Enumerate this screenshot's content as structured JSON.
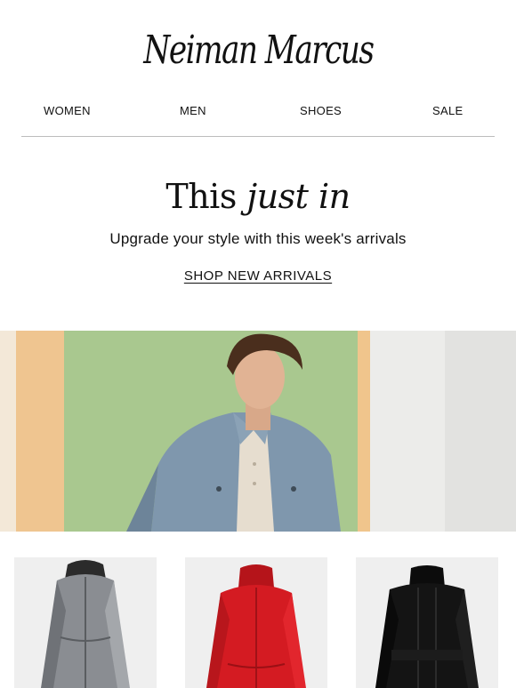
{
  "brand": {
    "logo_text": "Neiman Marcus"
  },
  "nav": {
    "items": [
      {
        "label": "WOMEN"
      },
      {
        "label": "MEN"
      },
      {
        "label": "SHOES"
      },
      {
        "label": "SALE"
      }
    ]
  },
  "promo": {
    "headline_plain": "This",
    "headline_italic": "just in",
    "subhead": "Upgrade your style with this week's arrivals",
    "cta_label": "SHOP NEW ARRIVALS"
  },
  "colors": {
    "text": "#111111",
    "divider": "#bdbdbd",
    "product_bg": "#efefef",
    "jacket_silver": "#8a8d92",
    "jacket_red": "#d41b22",
    "jacket_black": "#141414",
    "hero_green": "#a9c88f",
    "hero_denim": "#7f97ad"
  },
  "products": [
    {
      "item": "silver-hooded-jacket-image"
    },
    {
      "item": "red-jacket-image"
    },
    {
      "item": "black-puffer-jacket-image"
    }
  ]
}
